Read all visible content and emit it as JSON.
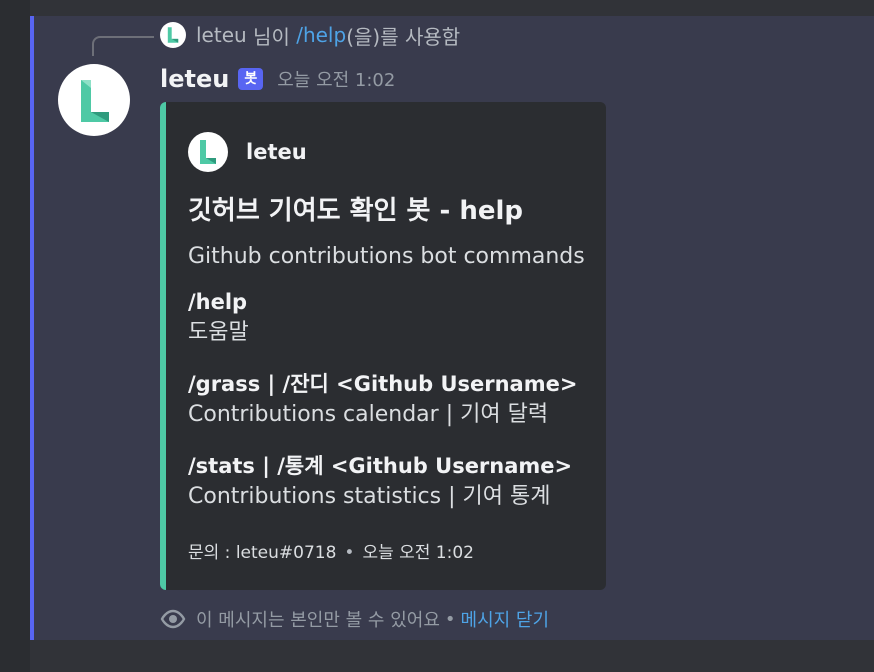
{
  "reply": {
    "author": "leteu",
    "text_before": " 님이 ",
    "command": "/help",
    "text_after": "(을)를 사용함"
  },
  "message": {
    "author": "leteu",
    "bot_tag": "봇",
    "timestamp": "오늘 오전 1:02"
  },
  "embed": {
    "color": "#4ec9a5",
    "author_name": "leteu",
    "title": "깃허브 기여도 확인 봇 - help",
    "description": "Github contributions bot commands",
    "fields": [
      {
        "name": "/help",
        "value": "도움말"
      },
      {
        "name": "/grass | /잔디 <Github Username>",
        "value": "Contributions calendar | 기여 달력"
      },
      {
        "name": "/stats | /통계 <Github Username>",
        "value": "Contributions statistics | 기여 통계"
      }
    ],
    "footer_text": "문의 : leteu#0718",
    "footer_separator": "•",
    "footer_time": "오늘 오전 1:02"
  },
  "ephemeral": {
    "icon": "eye-icon",
    "notice": "이 메시지는 본인만 볼 수 있어요",
    "separator": "•",
    "dismiss_label": "메시지 닫기"
  },
  "colors": {
    "accent": "#5865f2",
    "link": "#4ea3e6",
    "embed_bar": "#4ec9a5"
  }
}
